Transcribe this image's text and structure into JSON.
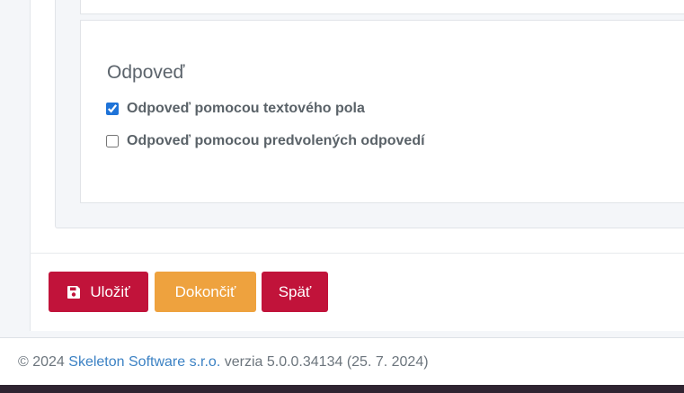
{
  "panel": {
    "title": "Odpoveď",
    "options": [
      {
        "label": "Odpoveď pomocou textového pola",
        "checked": true
      },
      {
        "label": "Odpoveď pomocou predvolených odpovedí",
        "checked": false
      }
    ]
  },
  "actions": {
    "save_label": "Uložiť",
    "save_icon": "save-icon",
    "finish_label": "Dokončiť",
    "back_label": "Späť"
  },
  "footer": {
    "copyright": "© 2024",
    "company": "Skeleton Software s.r.o.",
    "version": "verzia 5.0.0.34134 (25. 7. 2024)"
  },
  "colors": {
    "danger": "#c1133a",
    "warning": "#eea23e",
    "link": "#3c82c4"
  }
}
